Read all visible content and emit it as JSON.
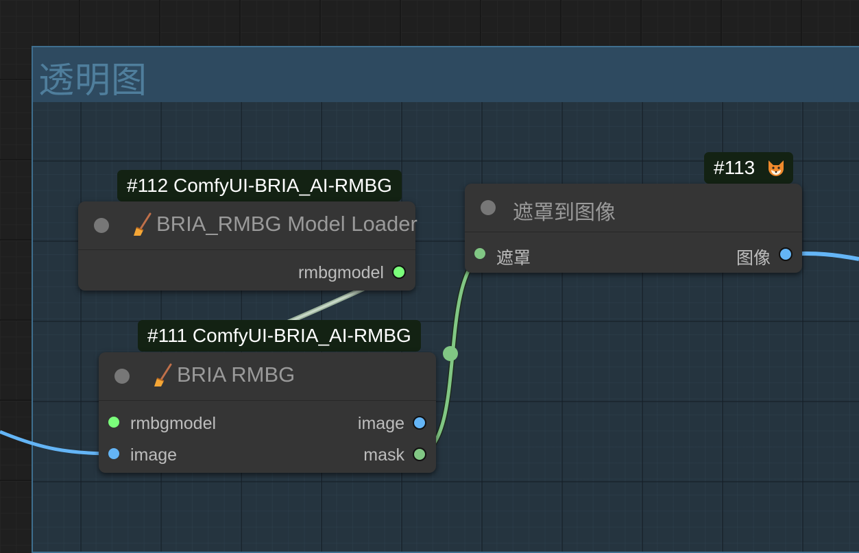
{
  "group": {
    "title": "透明图"
  },
  "colors": {
    "model_link": "#7bff7b",
    "image_link": "#64b5f6",
    "mask_link": "#81c784",
    "badge_bg": "#132213",
    "node_bg": "#353535"
  },
  "nodes": {
    "loader": {
      "badge": "#112 ComfyUI-BRIA_AI-RMBG",
      "title": "BRIA_RMBG Model Loader",
      "title_icon": "broom-icon",
      "outputs": [
        {
          "label": "rmbgmodel",
          "type": "model"
        }
      ]
    },
    "rmbg": {
      "badge": "#111 ComfyUI-BRIA_AI-RMBG",
      "title": "BRIA RMBG",
      "title_icon": "broom-icon",
      "inputs": [
        {
          "label": "rmbgmodel",
          "type": "model"
        },
        {
          "label": "image",
          "type": "image"
        }
      ],
      "outputs": [
        {
          "label": "image",
          "type": "image"
        },
        {
          "label": "mask",
          "type": "mask"
        }
      ]
    },
    "mask_to_image": {
      "badge": "#113",
      "badge_icon": "fox-icon",
      "title": "遮罩到图像",
      "inputs": [
        {
          "label": "遮罩",
          "type": "mask"
        }
      ],
      "outputs": [
        {
          "label": "图像",
          "type": "image"
        }
      ]
    }
  }
}
